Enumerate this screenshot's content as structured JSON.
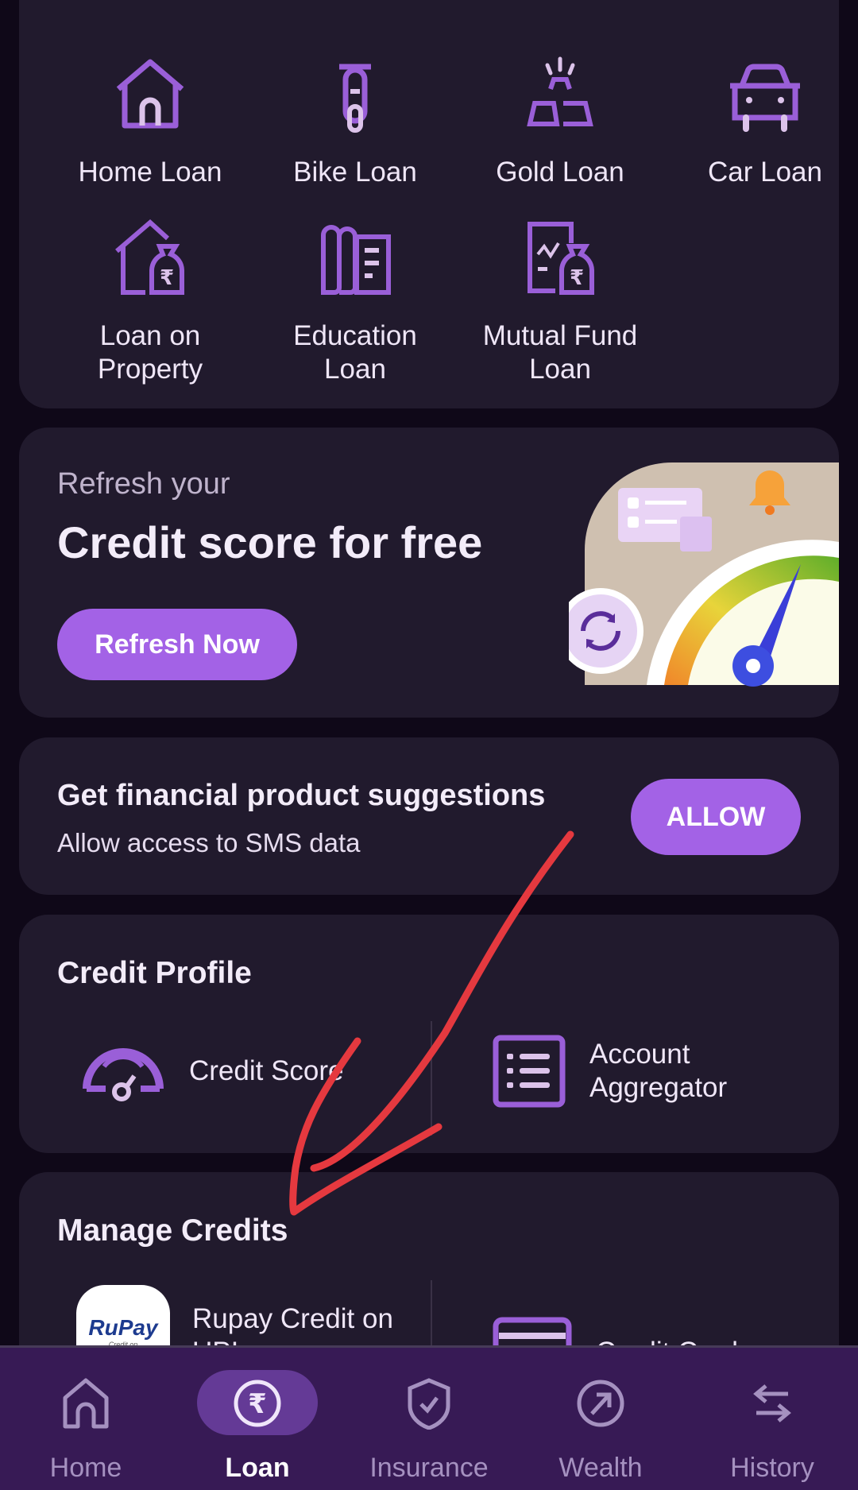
{
  "loan_types": [
    {
      "label": "Home Loan",
      "icon": "home-icon"
    },
    {
      "label": "Bike Loan",
      "icon": "scooter-icon"
    },
    {
      "label": "Gold Loan",
      "icon": "gold-bars-icon"
    },
    {
      "label": "Car Loan",
      "icon": "car-icon"
    },
    {
      "label": "Loan on\nProperty",
      "icon": "house-money-bag-icon"
    },
    {
      "label": "Education\nLoan",
      "icon": "book-icon"
    },
    {
      "label": "Mutual Fund\nLoan",
      "icon": "chart-money-bag-icon"
    }
  ],
  "credit_banner": {
    "subtitle": "Refresh your",
    "title": "Credit score for free",
    "button_label": "Refresh Now"
  },
  "sms_prompt": {
    "title": "Get financial product suggestions",
    "subtitle": "Allow access to SMS data",
    "button_label": "ALLOW"
  },
  "credit_profile": {
    "title": "Credit Profile",
    "items": [
      {
        "label": "Credit Score",
        "icon": "speedometer-icon"
      },
      {
        "label": "Account\nAggregator",
        "icon": "list-icon"
      }
    ]
  },
  "manage_credits": {
    "title": "Manage Credits",
    "items": [
      {
        "label": "Rupay Credit on\nUPI",
        "icon": "rupay-logo",
        "logo_text": "RuPay",
        "logo_sub": "Credit on"
      },
      {
        "label": "Credit Card",
        "icon": "credit-card-icon"
      }
    ]
  },
  "bottom_nav": {
    "active": "Loan",
    "items": [
      {
        "label": "Home",
        "icon": "home-icon"
      },
      {
        "label": "Loan",
        "icon": "rupee-circle-icon"
      },
      {
        "label": "Insurance",
        "icon": "shield-check-icon"
      },
      {
        "label": "Wealth",
        "icon": "arrow-up-right-circle-icon"
      },
      {
        "label": "History",
        "icon": "swap-arrows-icon"
      }
    ]
  },
  "colors": {
    "background": "#0f0818",
    "card": "#211a2d",
    "accent": "#a362e6",
    "icon_primary": "#9a5fd8",
    "icon_secondary": "#dcc3ea",
    "nav_background": "#371a55",
    "nav_active_pill": "#643a96",
    "annotation": "#e5393f"
  }
}
